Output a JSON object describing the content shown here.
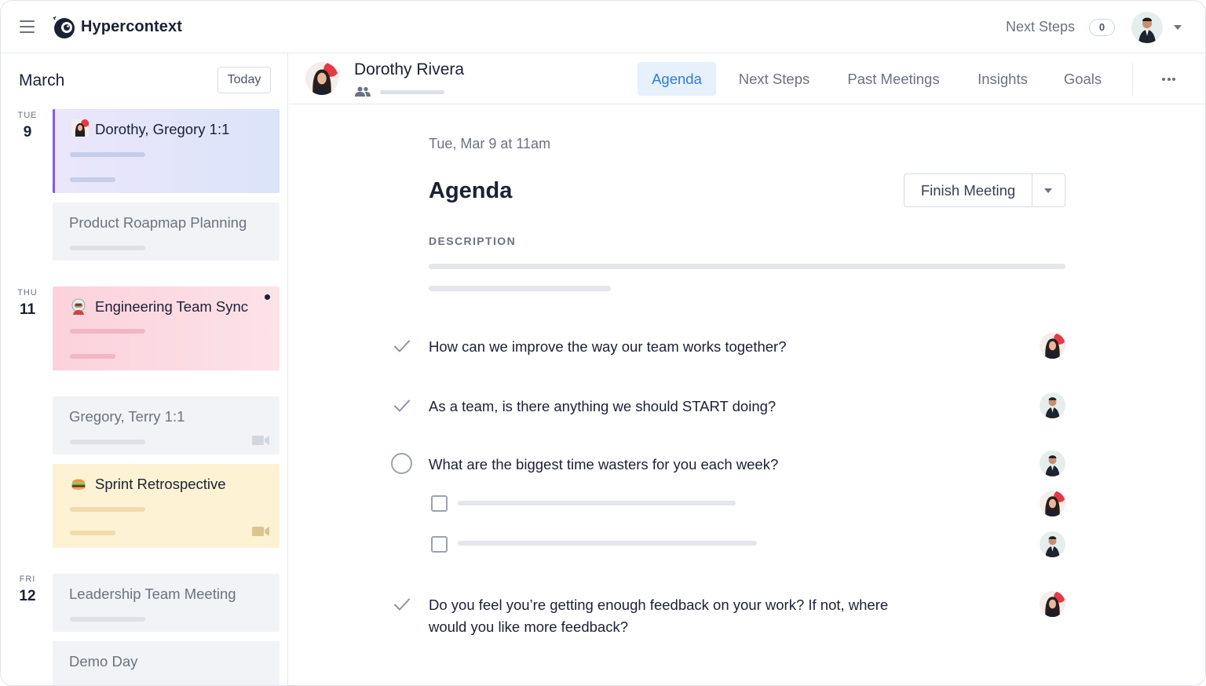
{
  "app": {
    "name": "Hypercontext"
  },
  "topbar": {
    "next_steps_label": "Next Steps",
    "next_steps_count": "0"
  },
  "sidebar": {
    "month": "March",
    "today_label": "Today",
    "days": [
      {
        "dow": "TUE",
        "num": "9"
      },
      {
        "dow": "THU",
        "num": "11"
      },
      {
        "dow": "FRI",
        "num": "12"
      }
    ],
    "meetings": [
      {
        "title": "Dorothy, Gregory 1:1"
      },
      {
        "title": "Product Roapmap Planning"
      },
      {
        "title": "Engineering Team Sync"
      },
      {
        "title": "Gregory, Terry 1:1"
      },
      {
        "title": "Sprint Retrospective"
      },
      {
        "title": "Leadership Team Meeting"
      },
      {
        "title": "Demo Day"
      }
    ]
  },
  "header": {
    "person_name": "Dorothy Rivera",
    "tabs": [
      {
        "label": "Agenda"
      },
      {
        "label": "Next Steps"
      },
      {
        "label": "Past Meetings"
      },
      {
        "label": "Insights"
      },
      {
        "label": "Goals"
      }
    ]
  },
  "main": {
    "date_line": "Tue, Mar 9 at 11am",
    "title": "Agenda",
    "finish_label": "Finish Meeting",
    "description_label": "DESCRIPTION",
    "items": [
      {
        "text": "How can we improve the way our team works together?",
        "status": "done"
      },
      {
        "text": "As a team, is there anything we should START doing?",
        "status": "done"
      },
      {
        "text": "What are the biggest time wasters for you each week?",
        "status": "open"
      },
      {
        "line1": "Do you feel you’re getting enough feedback on your work? If not, where",
        "line2": "would you like more feedback?",
        "status": "done"
      }
    ]
  },
  "colors": {
    "accent": "#2f7be0",
    "active_card_border": "#7f5ae6"
  }
}
